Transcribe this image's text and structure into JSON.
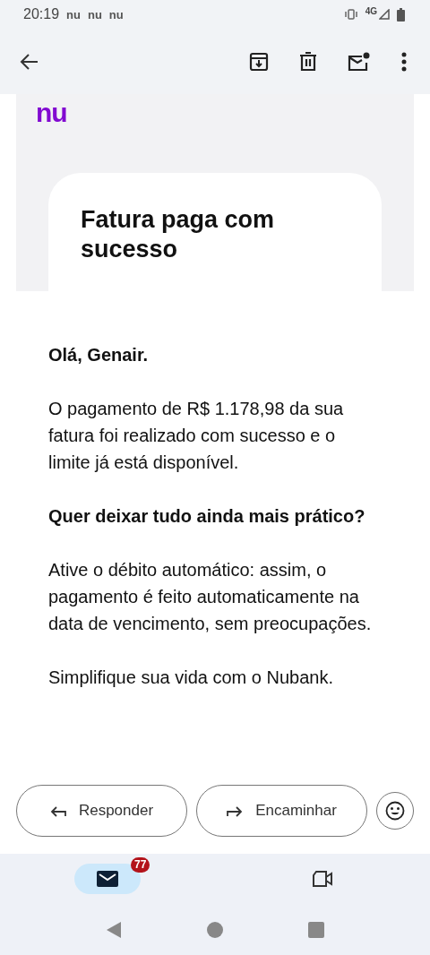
{
  "status_bar": {
    "time": "20:19",
    "notifications": [
      "nu",
      "nu",
      "nu"
    ],
    "network": "4G"
  },
  "email": {
    "logo": "nu",
    "title": "Fatura paga com sucesso",
    "paragraphs": [
      {
        "kind": "bold",
        "text": "Olá, Genair."
      },
      {
        "kind": "normal",
        "text": "O pagamento de R$ 1.178,98 da sua fatura foi realizado com sucesso e o limite já está disponível."
      },
      {
        "kind": "bold",
        "text": "Quer deixar tudo ainda mais prático?"
      },
      {
        "kind": "normal",
        "text": "Ative o débito automático: assim, o pagamento é feito automaticamente na data de vencimento, sem preocupações."
      },
      {
        "kind": "normal",
        "text": "Simplifique sua vida com o Nubank."
      }
    ]
  },
  "actions": [
    {
      "kind": "reply",
      "label": "Responder"
    },
    {
      "kind": "forward",
      "label": "Encaminhar"
    }
  ],
  "bottom_nav": [
    {
      "kind": "mail",
      "selected": true,
      "badge": "77"
    },
    {
      "kind": "video",
      "selected": false
    }
  ]
}
